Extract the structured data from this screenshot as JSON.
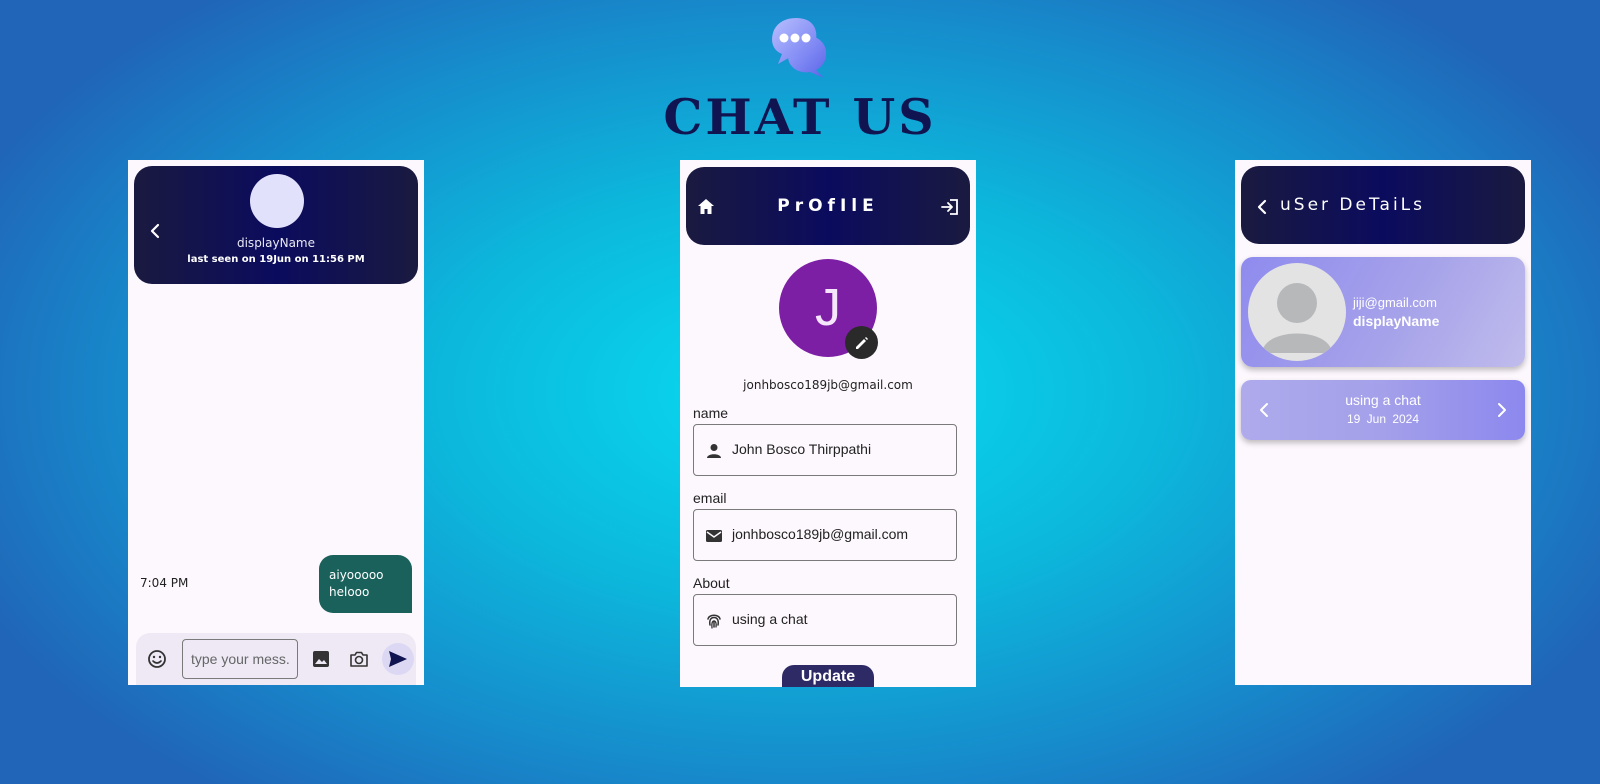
{
  "app": {
    "title": "CHAT US"
  },
  "chat": {
    "contact_name": "displayName",
    "last_seen": "last seen on 19Jun on 11:56 PM",
    "messages": [
      {
        "time": "7:04 PM",
        "text": "aiyooooo\nhelooo"
      }
    ],
    "input_placeholder": "type your mess..."
  },
  "profile": {
    "title": "PrOfIlE",
    "avatar_letter": "J",
    "email": "jonhbosco189jb@gmail.com",
    "fields": [
      {
        "label": "name",
        "value": "John Bosco Thirppathi"
      },
      {
        "label": "email",
        "value": "jonhbosco189jb@gmail.com"
      },
      {
        "label": "About",
        "value": "using a chat"
      }
    ],
    "update_label": "Update"
  },
  "details": {
    "title": "uSer DeTaiLs",
    "email": "jiji@gmail.com",
    "name": "displayName",
    "about": "using a chat",
    "date": "19 Jun 2024"
  },
  "colors": {
    "header_dark": "#0b0b5e",
    "avatar_purple": "#7d1fa5",
    "bubble_green": "#1a615c",
    "update_button": "#2d2a66",
    "card_lavender": "#a6a2ea"
  }
}
